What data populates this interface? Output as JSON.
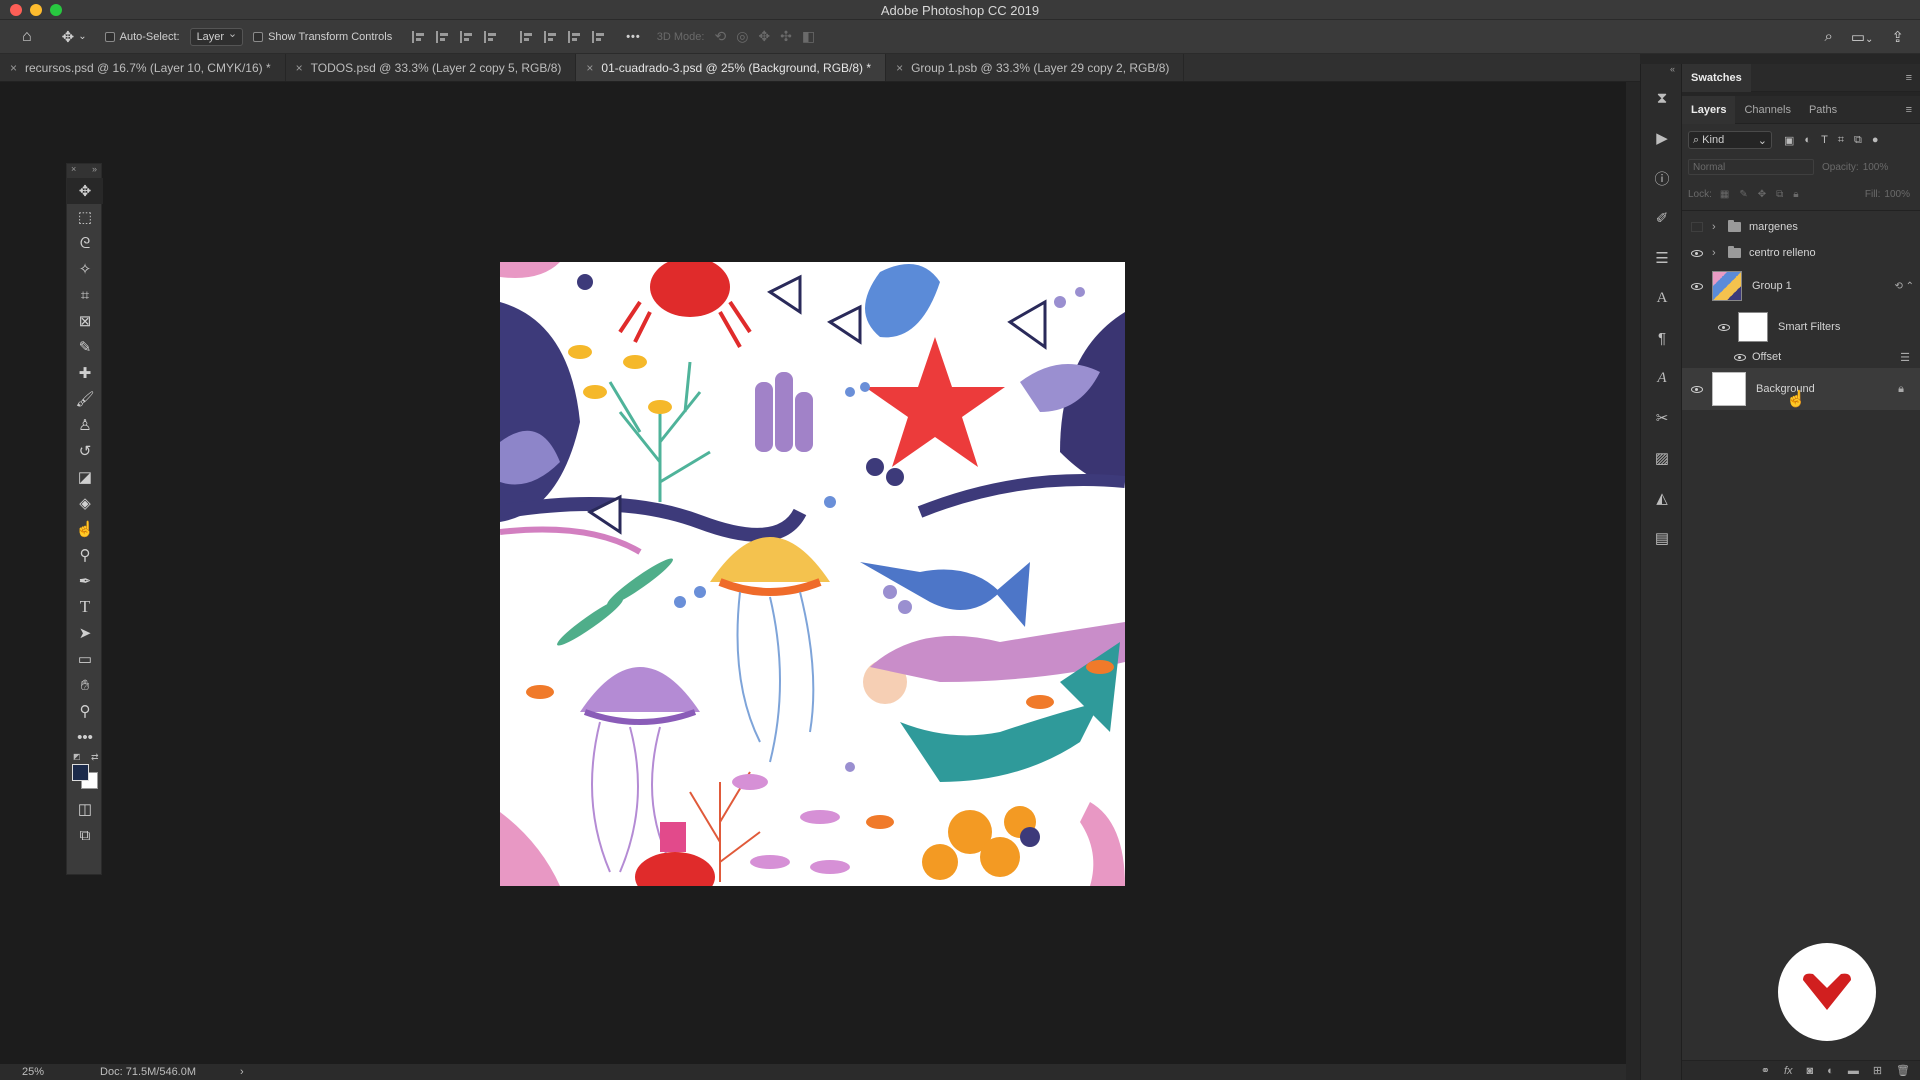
{
  "window": {
    "title": "Adobe Photoshop CC 2019"
  },
  "options_bar": {
    "auto_select_label": "Auto-Select:",
    "auto_select_value": "Layer",
    "transform_label": "Show Transform Controls",
    "mode_3d_label": "3D Mode:",
    "more": "•••"
  },
  "tabs": [
    {
      "label": "recursos.psd @ 16.7% (Layer 10, CMYK/16) *"
    },
    {
      "label": "TODOS.psd @ 33.3% (Layer 2 copy 5, RGB/8)"
    },
    {
      "label": "01-cuadrado-3.psd @ 25% (Background, RGB/8) *"
    },
    {
      "label": "Group 1.psb @ 33.3% (Layer 29 copy 2, RGB/8)"
    }
  ],
  "tools": [
    "move-tool",
    "marquee-tool",
    "lasso-tool",
    "magic-wand-tool",
    "crop-tool",
    "frame-tool",
    "eyedropper-tool",
    "healing-tool",
    "brush-tool",
    "stamp-tool",
    "history-brush-tool",
    "eraser-tool",
    "paint-bucket-tool",
    "smudge-tool",
    "dodge-tool",
    "pen-tool",
    "type-tool",
    "path-selection-tool",
    "rectangle-tool",
    "hand-tool",
    "zoom-tool",
    "more-tools"
  ],
  "colors": {
    "foreground": "#1b2a4a",
    "background": "#ffffff",
    "accent_logo": "#d11f1f"
  },
  "status": {
    "zoom": "25%",
    "doc": "Doc: 71.5M/546.0M"
  },
  "panels": {
    "swatches_title": "Swatches",
    "tabs": [
      "Layers",
      "Channels",
      "Paths"
    ],
    "filter_kind": "Kind",
    "blend_mode": "Normal",
    "opacity_label": "Opacity:",
    "opacity_value": "100%",
    "lock_label": "Lock:",
    "fill_label": "Fill:",
    "fill_value": "100%"
  },
  "layers": [
    {
      "name": "margenes",
      "type": "group"
    },
    {
      "name": "centro relleno",
      "type": "group"
    },
    {
      "name": "Group 1",
      "type": "smart-object"
    },
    {
      "name": "Smart Filters",
      "type": "smart-filters"
    },
    {
      "name": "Offset",
      "type": "filter"
    },
    {
      "name": "Background",
      "type": "background"
    }
  ]
}
